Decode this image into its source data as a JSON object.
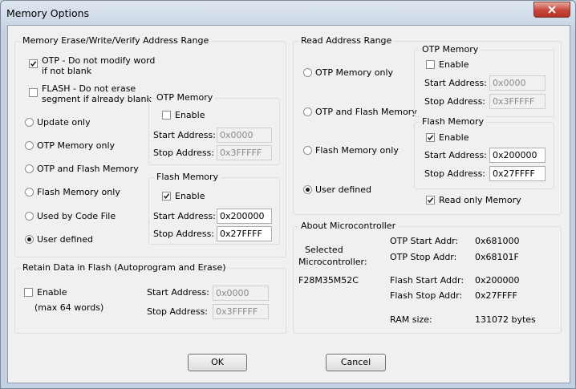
{
  "window": {
    "title": "Memory Options"
  },
  "erase_group": {
    "title": "Memory Erase/Write/Verify Address Range",
    "otp_no_modify": {
      "label_line1": "OTP - Do not modify word",
      "label_line2": "if not blank",
      "checked": true
    },
    "flash_no_erase": {
      "label_line1": "FLASH - Do not erase",
      "label_line2": "segment if already blank",
      "checked": false
    },
    "options": [
      {
        "label": "Update only",
        "selected": false
      },
      {
        "label": "OTP Memory only",
        "selected": false
      },
      {
        "label": "OTP and Flash Memory",
        "selected": false
      },
      {
        "label": "Flash Memory only",
        "selected": false
      },
      {
        "label": "Used by Code File",
        "selected": false
      },
      {
        "label": "User defined",
        "selected": true
      }
    ],
    "otp": {
      "title": "OTP Memory",
      "enable_label": "Enable",
      "enable_checked": false,
      "start_label": "Start Address:",
      "start_value": "0x0000",
      "stop_label": "Stop Address:",
      "stop_value": "0x3FFFFF"
    },
    "flash": {
      "title": "Flash Memory",
      "enable_label": "Enable",
      "enable_checked": true,
      "start_label": "Start Address:",
      "start_value": "0x200000",
      "stop_label": "Stop Address:",
      "stop_value": "0x27FFFF"
    }
  },
  "retain_group": {
    "title": "Retain Data in Flash   (Autoprogram and Erase)",
    "enable_label": "Enable",
    "enable_checked": false,
    "note": "(max 64 words)",
    "start_label": "Start Address:",
    "start_value": "0x0000",
    "stop_label": "Stop Address:",
    "stop_value": "0x3FFFFF"
  },
  "read_group": {
    "title": "Read Address Range",
    "options": [
      {
        "label": "OTP Memory only",
        "selected": false
      },
      {
        "label": "OTP and Flash Memory",
        "selected": false
      },
      {
        "label": "Flash Memory only",
        "selected": false
      },
      {
        "label": "User defined",
        "selected": true
      }
    ],
    "otp": {
      "title": "OTP Memory",
      "enable_label": "Enable",
      "enable_checked": false,
      "start_label": "Start Address:",
      "start_value": "0x0000",
      "stop_label": "Stop Address:",
      "stop_value": "0x3FFFFF"
    },
    "flash": {
      "title": "Flash Memory",
      "enable_label": "Enable",
      "enable_checked": true,
      "start_label": "Start Address:",
      "start_value": "0x200000",
      "stop_label": "Stop Address:",
      "stop_value": "0x27FFFF"
    },
    "read_only": {
      "label": "Read only Memory",
      "checked": true
    }
  },
  "about_group": {
    "title": "About Microcontroller",
    "selected_label_line1": "Selected",
    "selected_label_line2": "Microcontroller:",
    "device": "F28M35M52C",
    "otp_start_label": "OTP Start Addr:",
    "otp_start_value": "0x681000",
    "otp_stop_label": "OTP Stop Addr:",
    "otp_stop_value": "0x68101F",
    "flash_start_label": "Flash Start Addr:",
    "flash_start_value": "0x200000",
    "flash_stop_label": "Flash Stop Addr:",
    "flash_stop_value": "0x27FFFF",
    "ram_label": "RAM size:",
    "ram_value": "131072  bytes"
  },
  "buttons": {
    "ok": "OK",
    "cancel": "Cancel"
  }
}
